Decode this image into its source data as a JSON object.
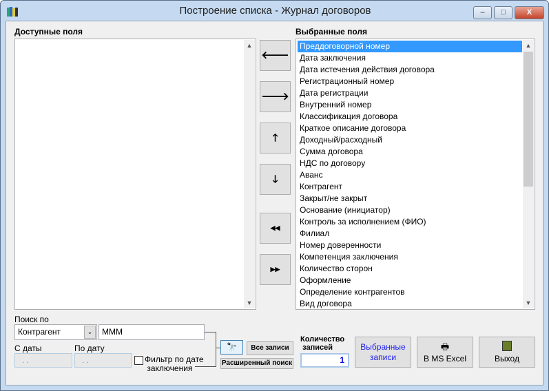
{
  "window": {
    "title": "Построение списка - Журнал договоров",
    "minimize": "‒",
    "maximize": "□",
    "close": "X"
  },
  "available": {
    "label": "Доступные поля",
    "items": []
  },
  "selected": {
    "label": "Выбранные поля",
    "items": [
      "Преддоговорной номер",
      "Дата заключения",
      "Дата истечения действия договора",
      "Регистрационный номер",
      "Дата регистрации",
      "Внутренний номер",
      "Классификация договора",
      "Краткое описание договора",
      "Доходный/расходный",
      "Сумма договора",
      "НДС по договору",
      "Аванс",
      "Контрагент",
      "Закрыт/не закрыт",
      "Основание (инициатор)",
      "Контроль за исполнением (ФИО)",
      "Филиал",
      "Номер доверенности",
      "Компетенция заключения",
      "Количество сторон",
      "Оформление",
      "Определение контрагентов",
      "Вид договора"
    ],
    "selected_index": 0
  },
  "move_buttons": {
    "left": "🡐",
    "right": "🡒",
    "up": "🡑",
    "down": "🡓",
    "all_left": "◀◀",
    "all_right": "▶▶"
  },
  "search": {
    "label": "Поиск по",
    "field": "Контрагент",
    "value": "МММ",
    "from_label": "С даты",
    "to_label": "По дату",
    "from_value": ". .",
    "to_value": ". .",
    "filter_label_1": "Фильтр по дате",
    "filter_label_2": "заключения",
    "filter_checked": false,
    "all_records": "Все записи",
    "advanced": "Расширенный поиск"
  },
  "count": {
    "label_1": "Количество",
    "label_2": "записей",
    "value": "1"
  },
  "actions": {
    "selected_records_1": "Выбранные",
    "selected_records_2": "записи",
    "excel": "В MS Excel",
    "exit": "Выход"
  }
}
